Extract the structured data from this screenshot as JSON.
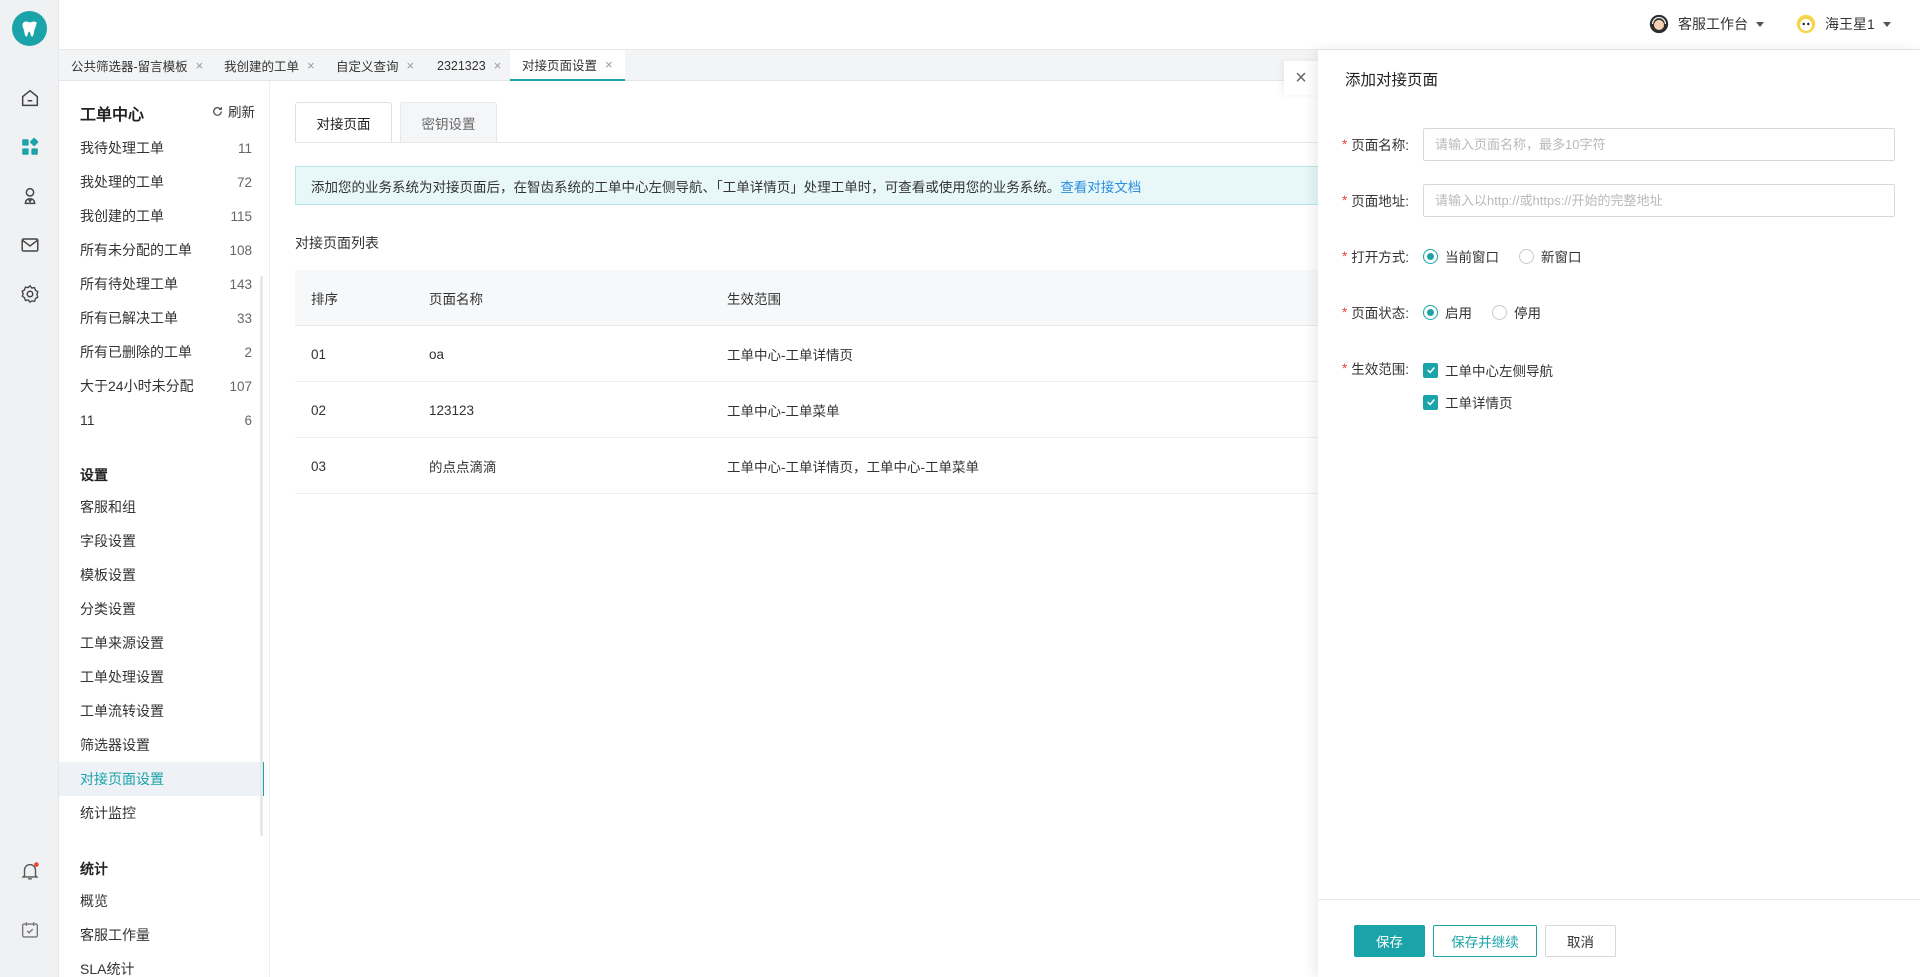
{
  "colors": {
    "accent": "#1aa3a8",
    "link": "#2b8de0",
    "required": "#f04134",
    "notice_bg": "#e8f8f8"
  },
  "header": {
    "workspace_label": "客服工作台",
    "user_name": "海王星1"
  },
  "tabs": [
    {
      "label": "公共筛选器-留言模板"
    },
    {
      "label": "我创建的工单"
    },
    {
      "label": "自定义查询"
    },
    {
      "label": "2321323"
    },
    {
      "label": "对接页面设置"
    }
  ],
  "sidebar": {
    "title": "工单中心",
    "refresh_label": "刷新",
    "ticket_items": [
      {
        "label": "我待处理工单",
        "count": "11"
      },
      {
        "label": "我处理的工单",
        "count": "72"
      },
      {
        "label": "我创建的工单",
        "count": "115"
      },
      {
        "label": "所有未分配的工单",
        "count": "108"
      },
      {
        "label": "所有待处理工单",
        "count": "143"
      },
      {
        "label": "所有已解决工单",
        "count": "33"
      },
      {
        "label": "所有已删除的工单",
        "count": "2"
      },
      {
        "label": "大于24小时未分配",
        "count": "107"
      },
      {
        "label": "11",
        "count": "6"
      }
    ],
    "settings_title": "设置",
    "settings_items": [
      {
        "label": "客服和组"
      },
      {
        "label": "字段设置"
      },
      {
        "label": "模板设置"
      },
      {
        "label": "分类设置"
      },
      {
        "label": "工单来源设置"
      },
      {
        "label": "工单处理设置"
      },
      {
        "label": "工单流转设置"
      },
      {
        "label": "筛选器设置"
      },
      {
        "label": "对接页面设置"
      },
      {
        "label": "统计监控"
      }
    ],
    "stats_title": "统计",
    "stats_items": [
      {
        "label": "概览"
      },
      {
        "label": "客服工作量"
      },
      {
        "label": "SLA统计"
      }
    ]
  },
  "main": {
    "subtabs": [
      {
        "label": "对接页面"
      },
      {
        "label": "密钥设置"
      }
    ],
    "notice_text": "添加您的业务系统为对接页面后，在智齿系统的工单中心左侧导航、「工单详情页」处理工单时，可查看或使用您的业务系统。",
    "notice_link": "查看对接文档",
    "list_title": "对接页面列表",
    "table": {
      "headers": [
        "排序",
        "页面名称",
        "生效范围"
      ],
      "rows": [
        {
          "order": "01",
          "name": "oa",
          "scope": "工单中心-工单详情页"
        },
        {
          "order": "02",
          "name": "123123",
          "scope": "工单中心-工单菜单"
        },
        {
          "order": "03",
          "name": "的点点滴滴",
          "scope": "工单中心-工单详情页，工单中心-工单菜单"
        }
      ]
    }
  },
  "drawer": {
    "title": "添加对接页面",
    "close_icon": "×",
    "fields": {
      "name_label": "页面名称:",
      "name_placeholder": "请输入页面名称，最多10字符",
      "url_label": "页面地址:",
      "url_placeholder": "请输入以http://或https://开始的完整地址",
      "open_label": "打开方式:",
      "open_options": [
        "当前窗口",
        "新窗口"
      ],
      "open_selected": "当前窗口",
      "status_label": "页面状态:",
      "status_options": [
        "启用",
        "停用"
      ],
      "status_selected": "启用",
      "scope_label": "生效范围:",
      "scope_options": [
        "工单中心左侧导航",
        "工单详情页"
      ]
    },
    "buttons": {
      "save": "保存",
      "save_continue": "保存并继续",
      "cancel": "取消"
    }
  }
}
